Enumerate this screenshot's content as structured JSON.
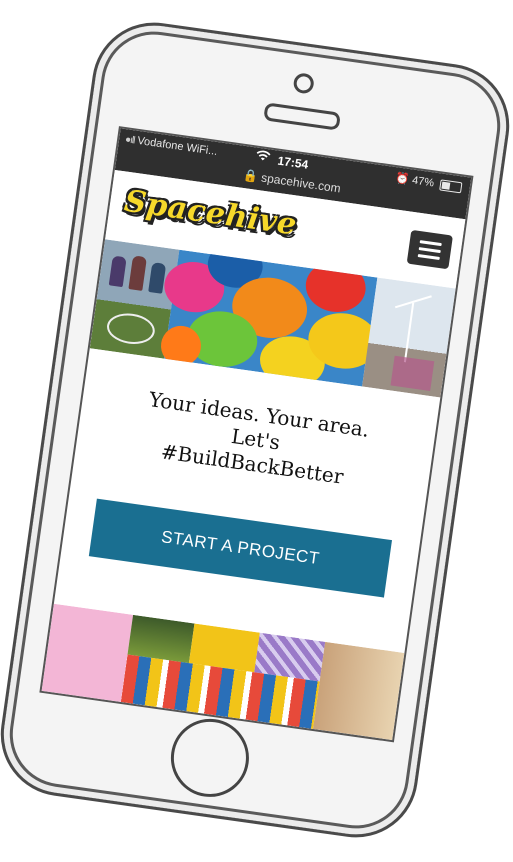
{
  "status_bar": {
    "carrier": "Vodafone WiFi...",
    "time": "17:54",
    "battery": "47%",
    "battery_level": 0.47,
    "url": "spacehive.com"
  },
  "header": {
    "logo_text": "Spacehive"
  },
  "hero": {
    "tagline_line1": "Your ideas. Your area.",
    "tagline_line2": "Let's",
    "tagline_line3": "#BuildBackBetter"
  },
  "cta": {
    "label": "START A PROJECT"
  },
  "colors": {
    "brand_yellow": "#f6d82a",
    "cta_blue": "#1a6f91",
    "status_bar": "#2f2f2f"
  },
  "icons": [
    "wifi-icon",
    "alarm-icon",
    "battery-icon",
    "lock-icon",
    "hamburger-menu-icon"
  ]
}
